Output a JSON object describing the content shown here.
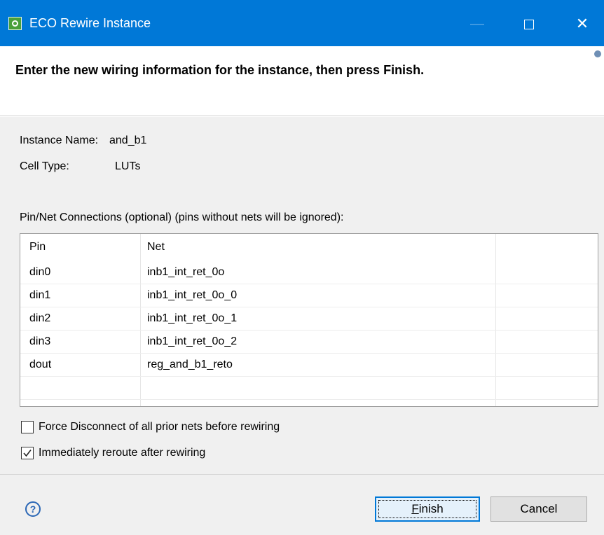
{
  "window": {
    "title": "ECO Rewire Instance",
    "minimize_symbol": "—",
    "close_symbol": "✕"
  },
  "banner": {
    "title": "Enter the new wiring information for the instance, then press Finish."
  },
  "info": {
    "instance_name_label": "Instance Name:",
    "instance_name_value": "and_b1",
    "cell_type_label": "Cell Type:",
    "cell_type_value": "LUTs"
  },
  "connections": {
    "label": "Pin/Net Connections (optional) (pins without nets will be ignored):",
    "columns": [
      "Pin",
      "Net"
    ],
    "rows": [
      {
        "pin": "din0",
        "net": "inb1_int_ret_0o"
      },
      {
        "pin": "din1",
        "net": "inb1_int_ret_0o_0"
      },
      {
        "pin": "din2",
        "net": "inb1_int_ret_0o_1"
      },
      {
        "pin": "din3",
        "net": "inb1_int_ret_0o_2"
      },
      {
        "pin": "dout",
        "net": "reg_and_b1_reto"
      },
      {
        "pin": "",
        "net": ""
      }
    ]
  },
  "options": {
    "force_disconnect": {
      "label": "Force Disconnect of all prior nets before rewiring",
      "checked": false
    },
    "immediately_reroute": {
      "label": "Immediately reroute after rewiring",
      "checked": true
    }
  },
  "footer": {
    "help_icon": "?",
    "finish_mnemonic": "F",
    "finish_rest": "inish",
    "cancel_label": "Cancel"
  },
  "colors": {
    "titlebar": "#0078d7",
    "dialog_bg": "#f0f0f0",
    "focus_border": "#0078d7"
  }
}
